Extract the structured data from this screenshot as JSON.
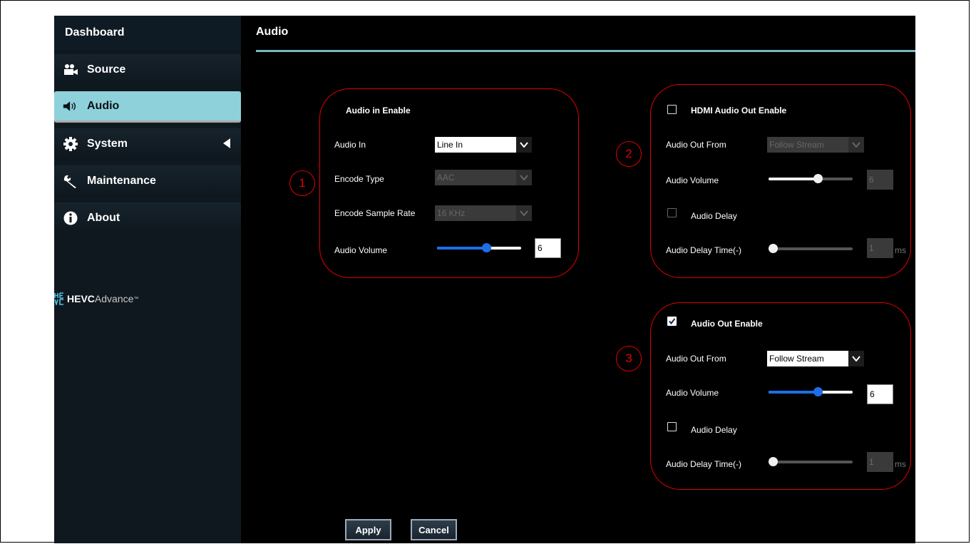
{
  "sidebar": {
    "header": "Dashboard",
    "items": [
      {
        "label": "Source",
        "icon": "video-camera-icon"
      },
      {
        "label": "Audio",
        "icon": "speaker-icon"
      },
      {
        "label": "System",
        "icon": "gear-icon"
      },
      {
        "label": "Maintenance",
        "icon": "wrench-icon"
      },
      {
        "label": "About",
        "icon": "info-icon"
      }
    ],
    "logo": {
      "mark": "HE VC",
      "bold": "HEVC",
      "light": "Advance",
      "tm": "™"
    }
  },
  "page": {
    "title": "Audio"
  },
  "audio_in": {
    "header": "Audio in Enable",
    "audio_in_label": "Audio In",
    "audio_in_value": "Line In",
    "encode_type_label": "Encode Type",
    "encode_type_value": "AAC",
    "sample_rate_label": "Encode Sample Rate",
    "sample_rate_value": "16 KHz",
    "volume_label": "Audio Volume",
    "volume_value": "6",
    "volume_fraction": 0.6
  },
  "hdmi_out": {
    "enable_label": "HDMI Audio Out Enable",
    "enabled": false,
    "out_from_label": "Audio Out From",
    "out_from_value": "Follow Stream",
    "volume_label": "Audio Volume",
    "volume_value": "6",
    "volume_fraction": 0.6,
    "delay_label": "Audio Delay",
    "delay_checked": false,
    "delay_time_label": "Audio Delay Time(-)",
    "delay_time_value": "1",
    "delay_unit": "ms"
  },
  "audio_out": {
    "enable_label": "Audio Out Enable",
    "enabled": true,
    "out_from_label": "Audio Out From",
    "out_from_value": "Follow Stream",
    "volume_label": "Audio Volume",
    "volume_value": "6",
    "volume_fraction": 0.6,
    "delay_label": "Audio Delay",
    "delay_checked": false,
    "delay_time_label": "Audio Delay Time(-)",
    "delay_time_value": "1",
    "delay_unit": "ms"
  },
  "buttons": {
    "apply": "Apply",
    "cancel": "Cancel"
  },
  "annotations": [
    "1",
    "2",
    "3"
  ],
  "colors": {
    "accent": "#8fd1da",
    "annotation": "#e00000",
    "slider_active": "#1e6ee6"
  }
}
